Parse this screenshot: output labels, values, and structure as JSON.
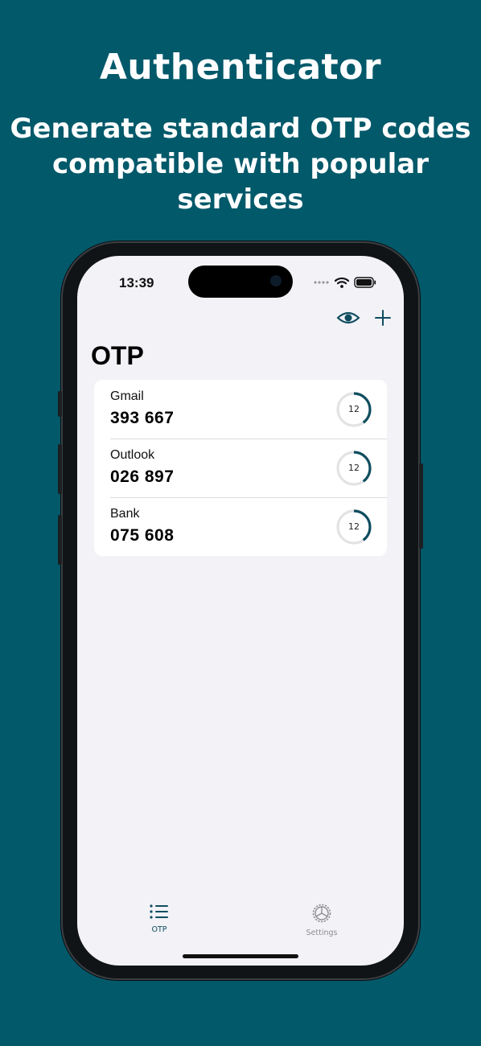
{
  "promo": {
    "title": "Authenticator",
    "subtitle_line1": "Generate standard OTP codes",
    "subtitle_line2": "compatible with popular services"
  },
  "colors": {
    "background": "#02596a",
    "accent": "#0f4d5f",
    "timer_track": "#e3e3e6",
    "screen_background": "#f2f2f7"
  },
  "status_bar": {
    "time": "13:39",
    "icons": [
      "signal-dots-icon",
      "wifi-icon",
      "battery-icon"
    ]
  },
  "nav": {
    "actions": [
      "eye-icon",
      "plus-icon"
    ]
  },
  "page": {
    "title": "OTP"
  },
  "otp_items": [
    {
      "name": "Gmail",
      "code": "393 667",
      "seconds_left": "12",
      "progress": 0.4
    },
    {
      "name": "Outlook",
      "code": "026 897",
      "seconds_left": "12",
      "progress": 0.4
    },
    {
      "name": "Bank",
      "code": "075 608",
      "seconds_left": "12",
      "progress": 0.4
    }
  ],
  "tabs": [
    {
      "label": "OTP",
      "icon": "list-icon",
      "active": true
    },
    {
      "label": "Settings",
      "icon": "gear-icon",
      "active": false
    }
  ]
}
